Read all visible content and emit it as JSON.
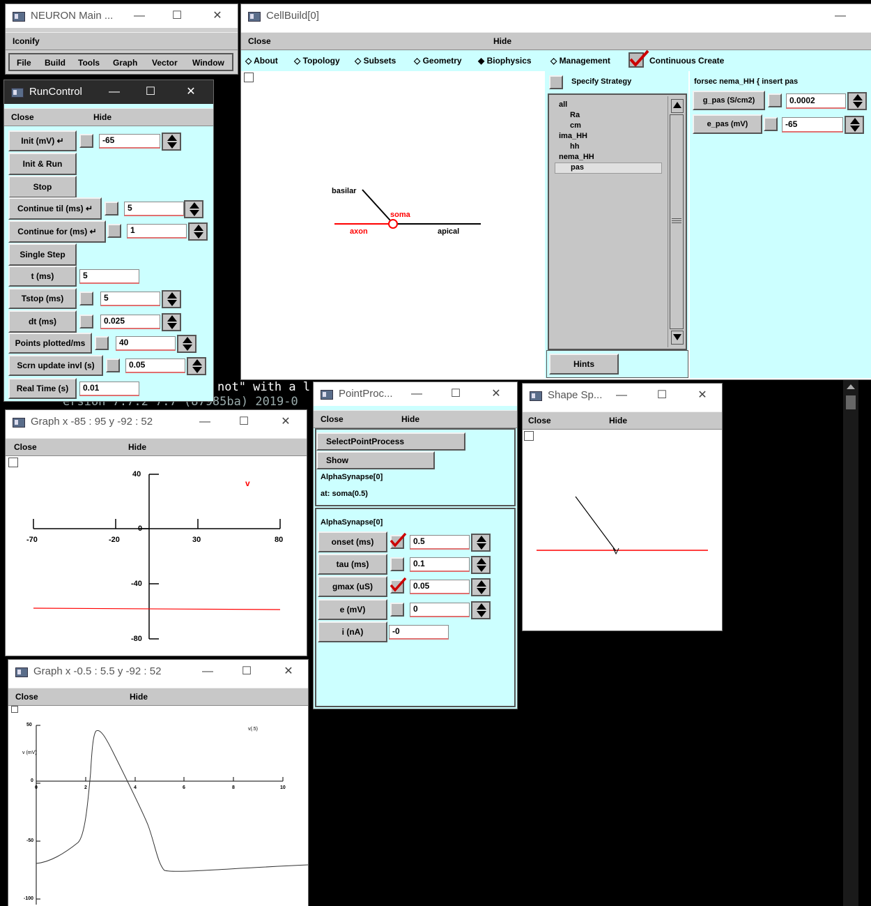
{
  "desktop": {
    "terminal_line_1": "not\" with a l",
    "terminal_line_2": "ersion 7.7.2 7.7 (87985ba) 2019-0"
  },
  "common": {
    "minimize": "—",
    "maximize": "☐",
    "close_x": "✕",
    "close": "Close",
    "hide": "Hide"
  },
  "neuron_main": {
    "title": "NEURON Main ...",
    "iconify": "Iconify",
    "menu": [
      "File",
      "Build",
      "Tools",
      "Graph",
      "Vector",
      "Window"
    ]
  },
  "cellbuild": {
    "title": "CellBuild[0]",
    "tabs": [
      "About",
      "Topology",
      "Subsets",
      "Geometry",
      "Biophysics",
      "Management"
    ],
    "continuous_create": "Continuous Create",
    "labels": {
      "basilar": "basilar",
      "soma": "soma",
      "axon": "axon",
      "apical": "apical"
    },
    "specify_strategy": "Specify Strategy",
    "tree": [
      "all",
      "Ra",
      "cm",
      "ima_HH",
      "hh",
      "nema_HH",
      "pas"
    ],
    "hints": "Hints",
    "forsec": "forsec nema_HH { insert pas",
    "g_pas_label": "g_pas (S/cm2)",
    "g_pas_value": "0.0002",
    "e_pas_label": "e_pas (mV)",
    "e_pas_value": "-65"
  },
  "runcontrol": {
    "title": "RunControl",
    "init_label": "Init (mV)",
    "init_value": "-65",
    "init_run": "Init & Run",
    "stop": "Stop",
    "continue_til": "Continue til (ms)",
    "continue_til_value": "5",
    "continue_for": "Continue for (ms)",
    "continue_for_value": "1",
    "single_step": "Single Step",
    "t_label": "t (ms)",
    "t_value": "5",
    "tstop_label": "Tstop (ms)",
    "tstop_value": "5",
    "dt_label": "dt (ms)",
    "dt_value": "0.025",
    "points_label": "Points plotted/ms",
    "points_value": "40",
    "scrn_label": "Scrn update invl (s)",
    "scrn_value": "0.05",
    "realtime_label": "Real Time (s)",
    "realtime_value": "0.01"
  },
  "graph1": {
    "title": "Graph  x -85 : 95  y -92 : 52",
    "x_ticks": [
      "-70",
      "-20",
      "30",
      "80"
    ],
    "y_ticks": [
      "40",
      "0",
      "-40",
      "-80"
    ],
    "marker": "v"
  },
  "graph2": {
    "title": "Graph  x -0.5 : 5.5  y -92 : 52",
    "ylabel": "v (mV)",
    "legend": "v(.5)",
    "x_ticks": [
      "0",
      "2",
      "4",
      "6",
      "8",
      "10"
    ],
    "y_ticks": [
      "50",
      "0",
      "-50",
      "-100"
    ]
  },
  "pointproc": {
    "title": "PointProc...",
    "select": "SelectPointProcess",
    "show": "Show",
    "name": "AlphaSynapse[0]",
    "at": "at: soma(0.5)",
    "name2": "AlphaSynapse[0]",
    "onset_label": "onset (ms)",
    "onset_value": "0.5",
    "tau_label": "tau (ms)",
    "tau_value": "0.1",
    "gmax_label": "gmax (uS)",
    "gmax_value": "0.05",
    "e_label": "e (mV)",
    "e_value": "0",
    "i_label": "i (nA)",
    "i_value": "-0"
  },
  "shape": {
    "title": "Shape Sp..."
  },
  "colors": {
    "panel": "#ccffff",
    "button": "#c6c6c6",
    "trace_red": "#ff0000",
    "check_red": "#cc0000"
  }
}
